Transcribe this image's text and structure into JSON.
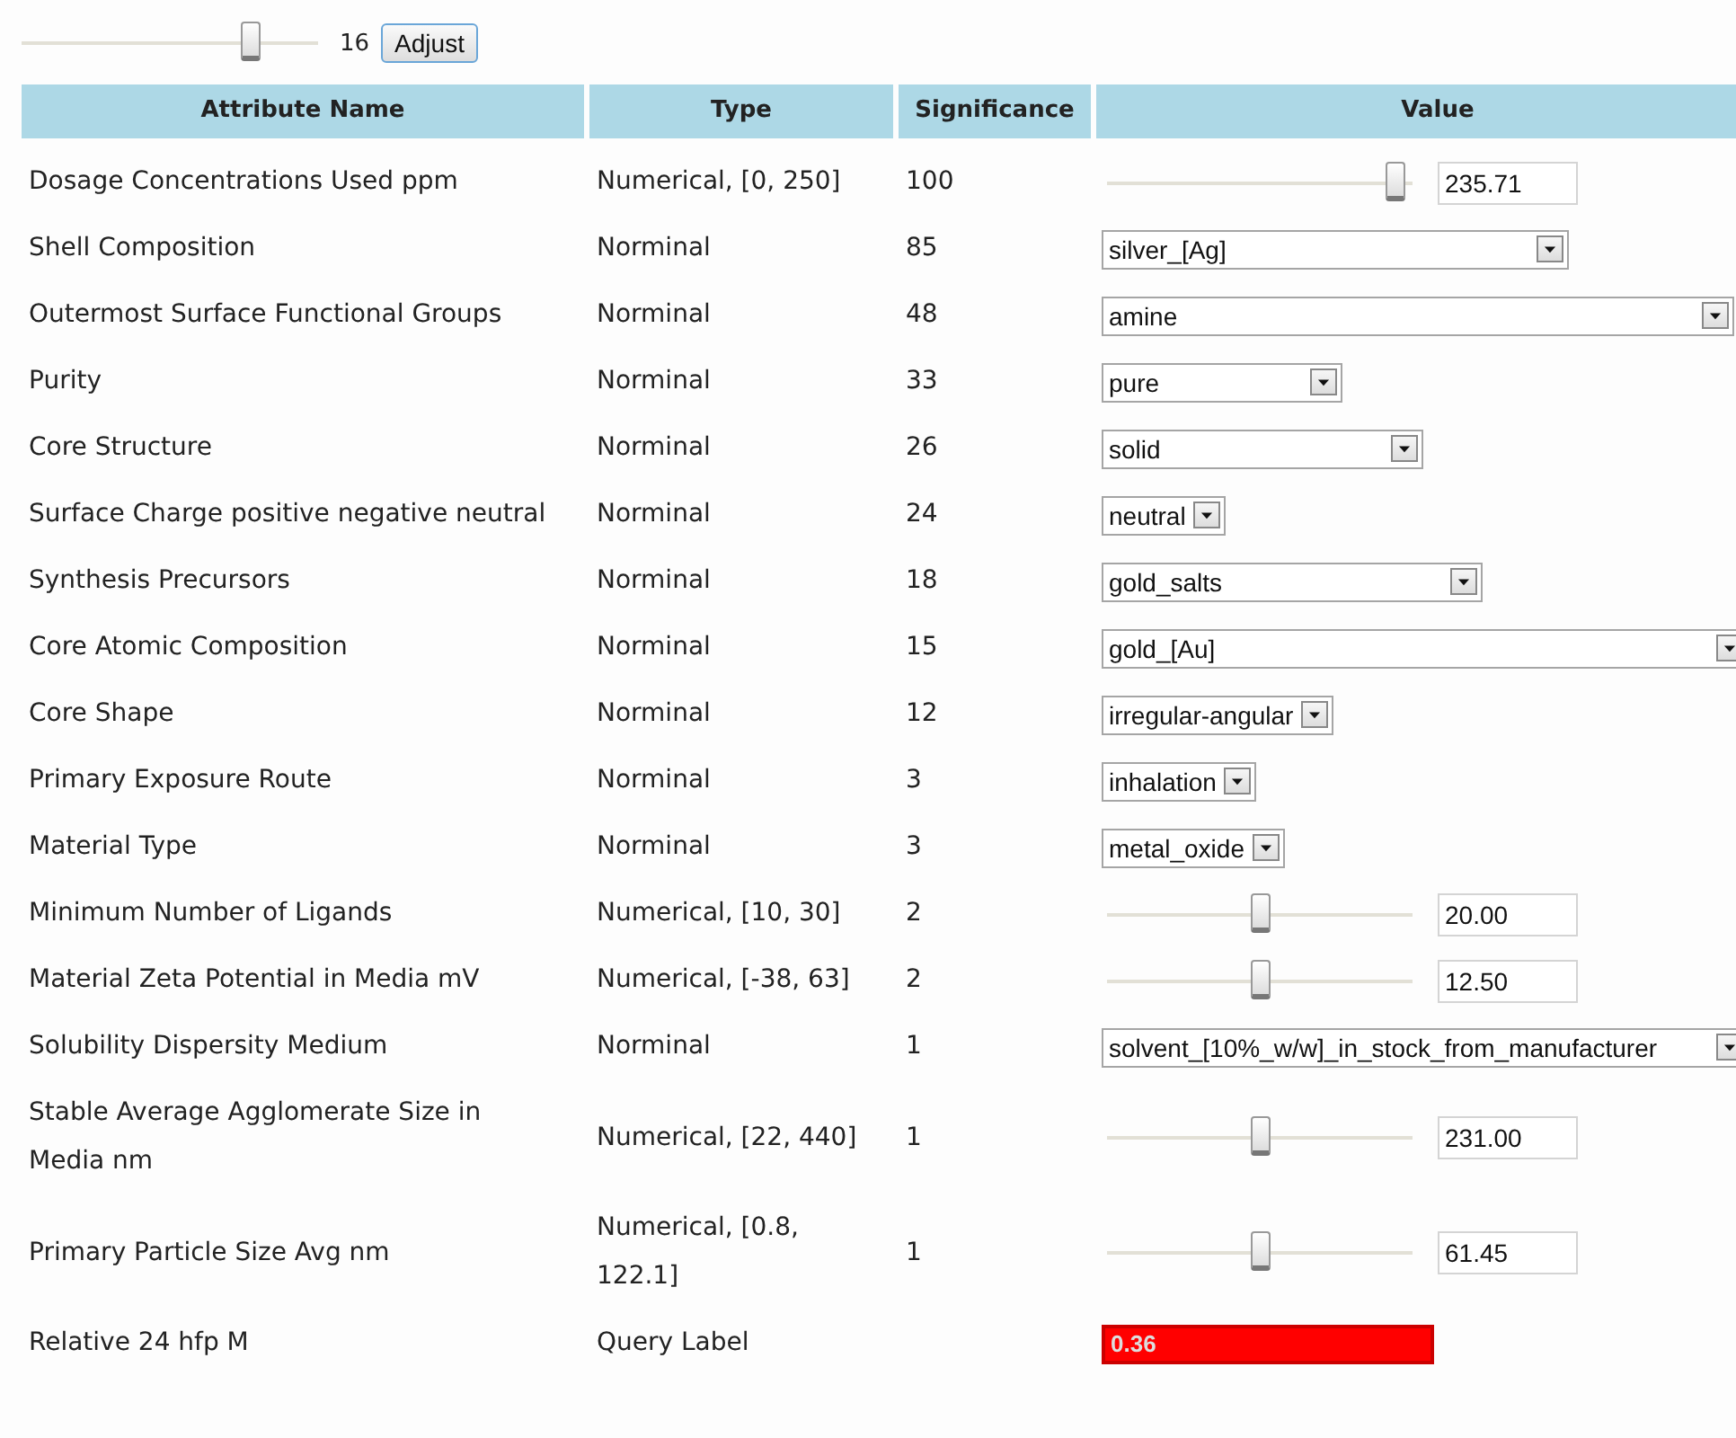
{
  "top_control": {
    "level": 0.77,
    "reading": "16",
    "button": "Adjust"
  },
  "table": {
    "columns": [
      "Attribute Name",
      "Type",
      "Significance",
      "Value"
    ],
    "rows": [
      {
        "name": "Dosage Concentrations Used ppm",
        "type": "Numerical, [0, 250]",
        "significance": "100",
        "kind": "slider",
        "level": 0.94,
        "value": "235.71"
      },
      {
        "name": "Shell Composition",
        "type": "Norminal",
        "significance": "85",
        "kind": "select",
        "value": "silver_[Ag]"
      },
      {
        "name": "Outermost Surface Functional Groups",
        "type": "Norminal",
        "significance": "48",
        "kind": "select",
        "value": "amine"
      },
      {
        "name": "Purity",
        "type": "Norminal",
        "significance": "33",
        "kind": "select",
        "value": "pure"
      },
      {
        "name": "Core Structure",
        "type": "Norminal",
        "significance": "26",
        "kind": "select",
        "value": "solid"
      },
      {
        "name": "Surface Charge positive negative neutral",
        "type": "Norminal",
        "significance": "24",
        "kind": "select",
        "value": "neutral"
      },
      {
        "name": "Synthesis Precursors",
        "type": "Norminal",
        "significance": "18",
        "kind": "select",
        "value": "gold_salts"
      },
      {
        "name": "Core Atomic Composition",
        "type": "Norminal",
        "significance": "15",
        "kind": "select",
        "value": "gold_[Au]"
      },
      {
        "name": "Core Shape",
        "type": "Norminal",
        "significance": "12",
        "kind": "select",
        "value": "irregular-angular"
      },
      {
        "name": "Primary Exposure Route",
        "type": "Norminal",
        "significance": "3",
        "kind": "select",
        "value": "inhalation"
      },
      {
        "name": "Material Type",
        "type": "Norminal",
        "significance": "3",
        "kind": "select",
        "value": "metal_oxide"
      },
      {
        "name": "Minimum Number of Ligands",
        "type": "Numerical, [10, 30]",
        "significance": "2",
        "kind": "slider",
        "level": 0.5,
        "value": "20.00"
      },
      {
        "name": "Material Zeta Potential in Media mV",
        "type": "Numerical, [-38, 63]",
        "significance": "2",
        "kind": "slider",
        "level": 0.5,
        "value": "12.50"
      },
      {
        "name": "Solubility Dispersity Medium",
        "type": "Norminal",
        "significance": "1",
        "kind": "select",
        "value": "solvent_[10%_w/w]_in_stock_from_manufacturer"
      },
      {
        "name": "Stable Average Agglomerate Size in Media nm",
        "type": "Numerical, [22, 440]",
        "significance": "1",
        "kind": "slider",
        "level": 0.5,
        "value": "231.00"
      },
      {
        "name": "Primary Particle Size Avg nm",
        "type": "Numerical, [0.8, 122.1]",
        "significance": "1",
        "kind": "slider",
        "level": 0.5,
        "value": "61.45"
      },
      {
        "name": "Relative 24 hfp M",
        "type": "Query Label",
        "significance": "",
        "kind": "label",
        "value": "0.36"
      }
    ]
  }
}
